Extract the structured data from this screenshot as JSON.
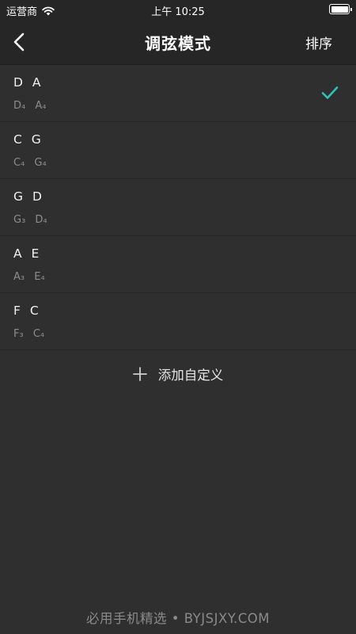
{
  "status_bar": {
    "carrier": "运营商",
    "time": "上午 10:25"
  },
  "nav": {
    "title": "调弦模式",
    "sort_label": "排序"
  },
  "tunings": [
    {
      "title": "D A",
      "notes": "D₄ A₄",
      "selected": true
    },
    {
      "title": "C G",
      "notes": "C₄ G₄",
      "selected": false
    },
    {
      "title": "G D",
      "notes": "G₃ D₄",
      "selected": false
    },
    {
      "title": "A E",
      "notes": "A₃ E₄",
      "selected": false
    },
    {
      "title": "F C",
      "notes": "F₃ C₄",
      "selected": false
    }
  ],
  "add_custom_label": "添加自定义",
  "watermark": "必用手机精选 • BYJSJXY.COM",
  "colors": {
    "accent_check": "#2ec4b6",
    "background": "#2f2f2f",
    "bar_background": "#262626"
  },
  "icons": {
    "back": "chevron-left-icon",
    "check": "checkmark-icon",
    "add": "plus-icon",
    "wifi": "wifi-icon",
    "battery": "battery-icon"
  }
}
